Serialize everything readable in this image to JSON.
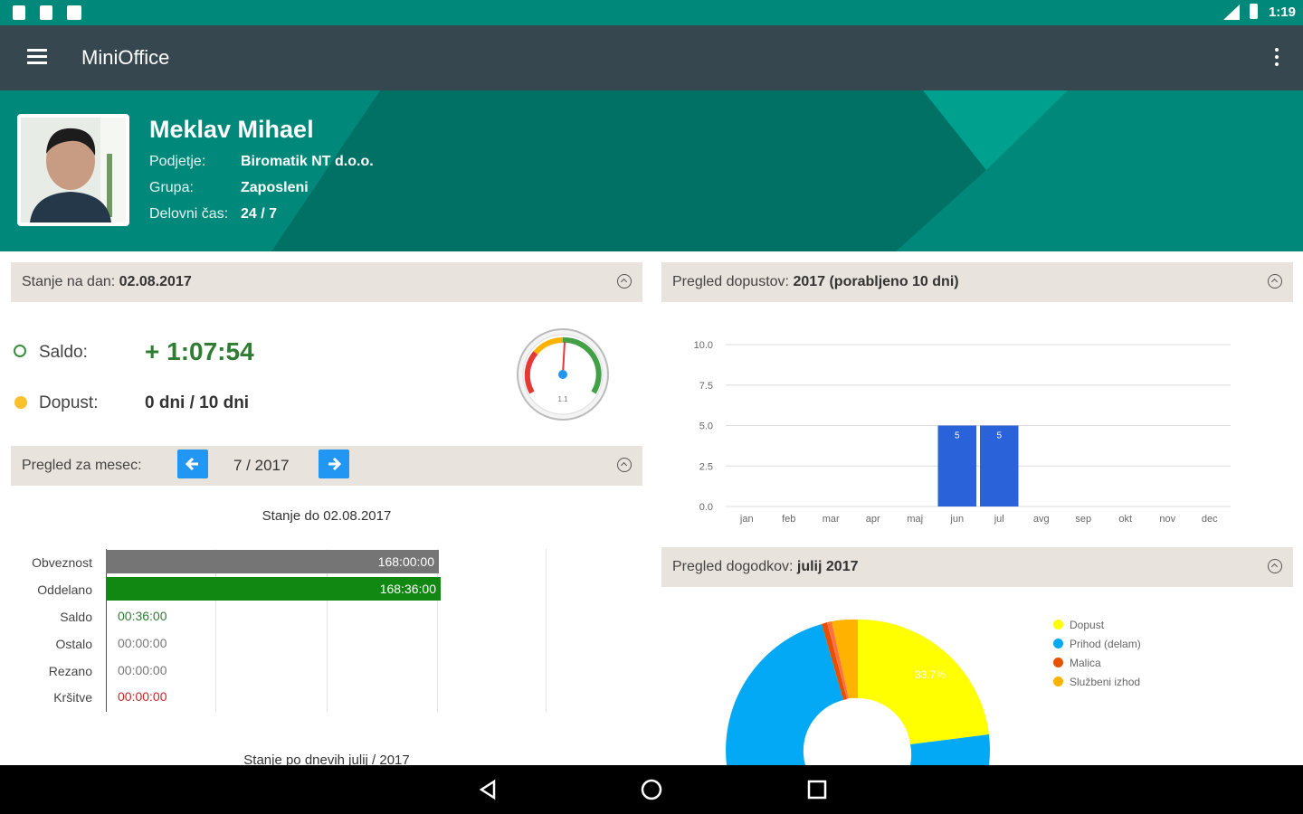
{
  "status_bar": {
    "time": "1:19"
  },
  "app_bar": {
    "title": "MiniOffice"
  },
  "profile": {
    "name": "Meklav Mihael",
    "rows": [
      {
        "label": "Podjetje:",
        "value": "Biromatik NT d.o.o."
      },
      {
        "label": "Grupa:",
        "value": "Zaposleni"
      },
      {
        "label": "Delovni čas:",
        "value": "24 / 7"
      }
    ]
  },
  "state_panel": {
    "label": "Stanje na dan:",
    "date": "02.08.2017",
    "saldo_label": "Saldo:",
    "saldo_value": "+ 1:07:54",
    "dopust_label": "Dopust:",
    "dopust_value": "0 dni / 10 dni",
    "gauge_value": "1.1"
  },
  "month_panel": {
    "label": "Pregled za mesec:",
    "month": "7 / 2017",
    "stanje_label": "Stanje do",
    "stanje_date": "02.08.2017",
    "rows": [
      {
        "label": "Obveznost",
        "value": "168:00:00",
        "color": "#757575"
      },
      {
        "label": "Oddelano",
        "value": "168:36:00",
        "color": "#118811"
      },
      {
        "label": "Saldo",
        "value": "00:36:00",
        "color": "#2e7d32"
      },
      {
        "label": "Ostalo",
        "value": "00:00:00",
        "color": "#777777"
      },
      {
        "label": "Rezano",
        "value": "00:00:00",
        "color": "#777777"
      },
      {
        "label": "Kršitve",
        "value": "00:00:00",
        "color": "#c62828"
      }
    ],
    "footer": "Stanje po dnevih julij / 2017"
  },
  "vacation_panel": {
    "label": "Pregled dopustov:",
    "value": "2017 (porabljeno 10 dni)"
  },
  "events_panel": {
    "label": "Pregled dogodkov:",
    "value": "julij 2017",
    "donut_label": "33.7%",
    "legend": [
      {
        "label": "Dopust",
        "color": "#ffff00"
      },
      {
        "label": "Prihod (delam)",
        "color": "#03a9f4"
      },
      {
        "label": "Malica",
        "color": "#e65100"
      },
      {
        "label": "Službeni izhod",
        "color": "#ffb300"
      }
    ]
  },
  "chart_data": {
    "type": "bar",
    "categories": [
      "jan",
      "feb",
      "mar",
      "apr",
      "maj",
      "jun",
      "jul",
      "avg",
      "sep",
      "okt",
      "nov",
      "dec"
    ],
    "values": [
      0,
      0,
      0,
      0,
      0,
      5,
      5,
      0,
      0,
      0,
      0,
      0
    ],
    "yticks": [
      "10.0",
      "7.5",
      "5.0",
      "2.5",
      "0.0"
    ],
    "ylim": [
      0,
      10
    ],
    "bar_color": "#2962d9",
    "grid": true
  }
}
